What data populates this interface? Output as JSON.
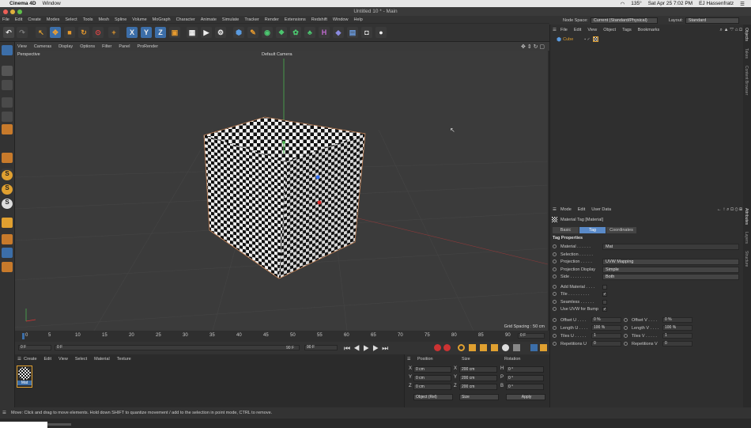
{
  "mac": {
    "app": "Cinema 4D",
    "window_menu": "Window",
    "percent": "135°",
    "date": "Sat Apr 25  7:02 PM",
    "user": "EJ Hassenfratz"
  },
  "title": "Untitled 10 * - Main",
  "menu": [
    "File",
    "Edit",
    "Create",
    "Modes",
    "Select",
    "Tools",
    "Mesh",
    "Spline",
    "Volume",
    "MoGraph",
    "Character",
    "Animate",
    "Simulate",
    "Tracker",
    "Render",
    "Extensions",
    "Redshift",
    "Window",
    "Help"
  ],
  "nodespace": {
    "label": "Node Space:",
    "value": "Current (Standard/Physical)",
    "layout_label": "Layout:",
    "layout_value": "Standard"
  },
  "viewport": {
    "menu": [
      "View",
      "Cameras",
      "Display",
      "Options",
      "Filter",
      "Panel",
      "ProRender"
    ],
    "name": "Perspective",
    "camera": "Default Camera",
    "grid": "Grid Spacing : 50 cm"
  },
  "timeline": {
    "ticks": [
      "0",
      "5",
      "10",
      "15",
      "20",
      "25",
      "30",
      "35",
      "40",
      "45",
      "50",
      "55",
      "60",
      "65",
      "70",
      "75",
      "80",
      "85",
      "90"
    ],
    "frame_end": "0 F"
  },
  "transport": {
    "start": "0 F",
    "current": "0 F",
    "end": "90 F",
    "end2": "90 F"
  },
  "matmgr": {
    "menu": [
      "Create",
      "Edit",
      "View",
      "Select",
      "Material",
      "Texture"
    ],
    "material": "Mat"
  },
  "coords": {
    "headers": [
      "Position",
      "Size",
      "Rotation"
    ],
    "rows": [
      {
        "a": "X",
        "pos": "0 cm",
        "b": "X",
        "size": "200 cm",
        "c": "H",
        "rot": "0 °"
      },
      {
        "a": "Y",
        "pos": "0 cm",
        "b": "Y",
        "size": "200 cm",
        "c": "P",
        "rot": "0 °"
      },
      {
        "a": "Z",
        "pos": "0 cm",
        "b": "Z",
        "size": "200 cm",
        "c": "B",
        "rot": "0 °"
      }
    ],
    "mode": "Object (Rel)",
    "size_mode": "Size",
    "apply": "Apply"
  },
  "status": "Move: Click and drag to move elements. Hold down SHIFT to quantize movement / add to the selection in point mode, CTRL to remove.",
  "objmgr": {
    "menu": [
      "File",
      "Edit",
      "View",
      "Object",
      "Tags",
      "Bookmarks"
    ],
    "object": "Cube"
  },
  "attr": {
    "menu": [
      "Mode",
      "Edit",
      "User Data"
    ],
    "title": "Material Tag [Material]",
    "tabs": [
      "Basic",
      "Tag",
      "Coordinates"
    ],
    "section": "Tag Properties",
    "props": [
      {
        "label": "Material . . . . . .",
        "value": "Mat"
      },
      {
        "label": "Selection . . . . . .",
        "value": ""
      },
      {
        "label": "Projection . . . . .",
        "value": "UVW Mapping"
      },
      {
        "label": "Projection Display",
        "value": "Simple"
      },
      {
        "label": "Side . . . . . . . . .",
        "value": "Both"
      }
    ],
    "checks": [
      {
        "label": "Add Material . . . .",
        "checked": ""
      },
      {
        "label": "Tile . . . . . . . . .",
        "checked": "✓"
      },
      {
        "label": "Seamless . . . . . .",
        "checked": ""
      },
      {
        "label": "Use UVW for Bump",
        "checked": "✓"
      }
    ],
    "nums": [
      {
        "l1": "Offset U . . . .",
        "v1": "0 %",
        "l2": "Offset V . . . .",
        "v2": "0 %"
      },
      {
        "l1": "Length U . . . .",
        "v1": "100 %",
        "l2": "Length V . . . .",
        "v2": "100 %"
      },
      {
        "l1": "Tiles U . . . . .",
        "v1": "1",
        "l2": "Tiles V . . . . .",
        "v2": "1"
      },
      {
        "l1": "Repetitions U",
        "v1": "0",
        "l2": "Repetitions V",
        "v2": "0"
      }
    ]
  },
  "sidetabs": [
    "Objects",
    "Takes",
    "Content Browser",
    "Attributes",
    "Layers",
    "Structure"
  ]
}
